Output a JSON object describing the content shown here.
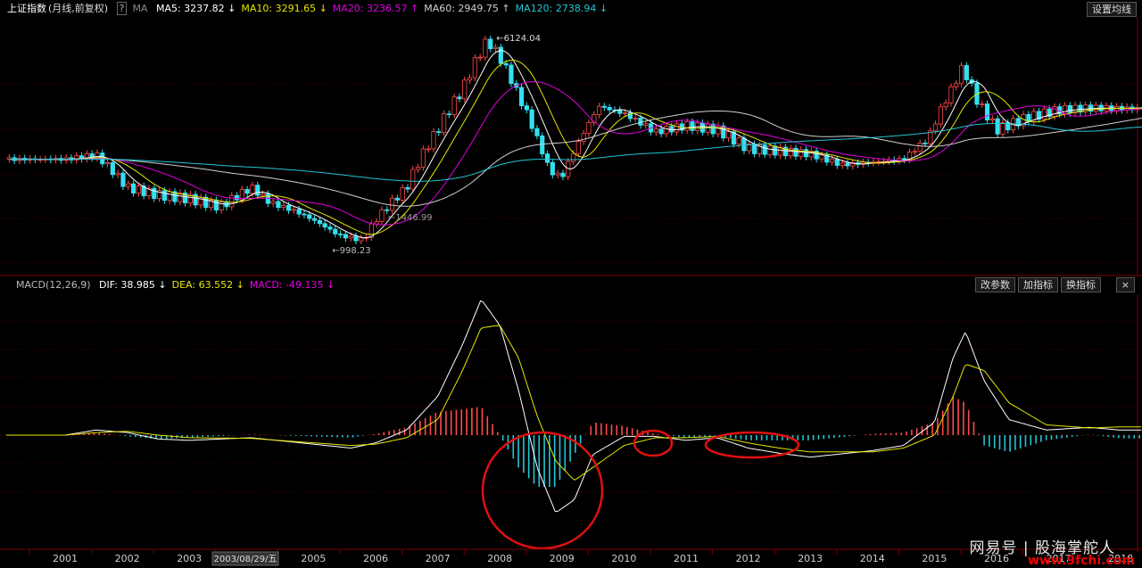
{
  "kline_header": {
    "title": "上证指数",
    "mode": "(月线,前复权)",
    "ma_label": "MA",
    "items": [
      {
        "text": "MA5: 3237.82 ↓",
        "color": "#ffffff"
      },
      {
        "text": "MA10: 3291.65 ↓",
        "color": "#e6e600"
      },
      {
        "text": "MA20: 3236.57 ↑",
        "color": "#e000e0"
      },
      {
        "text": "MA60: 2949.75 ↑",
        "color": "#cfcfcf"
      },
      {
        "text": "MA120: 2738.94 ↓",
        "color": "#23c6d6"
      }
    ],
    "set_ma_button": "设置均线"
  },
  "macd_header": {
    "title": "MACD(12,26,9)",
    "items": [
      {
        "text": "DIF: 38.985 ↓",
        "color": "#ffffff"
      },
      {
        "text": "DEA: 63.552 ↓",
        "color": "#e6e600"
      },
      {
        "text": "MACD: -49.135 ↓",
        "color": "#e000e0"
      }
    ],
    "buttons": [
      "改参数",
      "加指标",
      "换指标"
    ]
  },
  "price_annotations": {
    "high": "6124.04",
    "low": "998.23",
    "mid_low": "1446.99"
  },
  "cursor_date": "2003/08/29/五",
  "watermark": {
    "text": "网易号 | 股海掌舵人",
    "site": "www.9fchi.com"
  },
  "chart_data": {
    "type": "line",
    "title": "上证指数 (月线,前复权)",
    "x_labels": [
      "2001",
      "2002",
      "2003",
      "2004",
      "2005",
      "2006",
      "2007",
      "2008",
      "2009",
      "2010",
      "2011",
      "2012",
      "2013",
      "2014",
      "2015",
      "2016",
      "2017",
      "2018"
    ],
    "price_series": {
      "name": "上证指数",
      "x": [
        2001.0,
        2001.5,
        2002.0,
        2002.5,
        2003.0,
        2003.5,
        2004.0,
        2004.3,
        2004.7,
        2005.0,
        2005.4,
        2005.8,
        2006.0,
        2006.5,
        2007.0,
        2007.4,
        2007.8,
        2008.0,
        2008.3,
        2008.6,
        2008.8,
        2009.0,
        2009.3,
        2009.6,
        2010.0,
        2010.5,
        2011.0,
        2011.5,
        2012.0,
        2012.5,
        2013.0,
        2013.5,
        2014.0,
        2014.5,
        2014.9,
        2015.3,
        2015.45,
        2015.7,
        2016.0,
        2016.5,
        2017.0,
        2017.5,
        2018.0
      ],
      "y": [
        2100,
        2180,
        1650,
        1550,
        1500,
        1400,
        1650,
        1450,
        1350,
        1250,
        1100,
        1050,
        1250,
        1650,
        2700,
        3800,
        5800,
        5000,
        3600,
        2500,
        1900,
        1800,
        2500,
        3300,
        3100,
        2650,
        2800,
        2700,
        2300,
        2250,
        2200,
        2000,
        2050,
        2100,
        2500,
        3900,
        4600,
        3400,
        2700,
        3000,
        3200,
        3250,
        3240
      ]
    },
    "indicators": {
      "MA5": 3237.82,
      "MA10": 3291.65,
      "MA20": 3236.57,
      "MA60": 2949.75,
      "MA120": 2738.94,
      "DIF": 38.985,
      "DEA": 63.552,
      "MACD": -49.135
    },
    "macd": {
      "x": [
        2001.0,
        2001.5,
        2002.0,
        2002.5,
        2003.0,
        2004.0,
        2005.0,
        2005.6,
        2006.0,
        2006.5,
        2007.0,
        2007.4,
        2007.7,
        2008.0,
        2008.3,
        2008.6,
        2008.9,
        2009.2,
        2009.5,
        2010.0,
        2010.5,
        2011.0,
        2011.5,
        2012.0,
        2012.5,
        2013.0,
        2014.0,
        2014.5,
        2015.0,
        2015.3,
        2015.5,
        2015.8,
        2016.2,
        2016.8,
        2017.5,
        2018.0
      ],
      "dif": [
        0,
        40,
        20,
        -30,
        -40,
        -20,
        -70,
        -100,
        -60,
        40,
        300,
        700,
        1050,
        850,
        350,
        -250,
        -600,
        -500,
        -150,
        -10,
        -10,
        -40,
        -20,
        -100,
        -140,
        -170,
        -120,
        -80,
        100,
        600,
        800,
        420,
        120,
        40,
        60,
        39
      ],
      "dea": [
        0,
        20,
        30,
        0,
        -20,
        -25,
        -60,
        -80,
        -70,
        -20,
        120,
        500,
        830,
        850,
        600,
        150,
        -200,
        -350,
        -250,
        -80,
        -20,
        -20,
        -10,
        -60,
        -100,
        -130,
        -130,
        -100,
        0,
        300,
        550,
        500,
        250,
        80,
        55,
        64
      ]
    }
  }
}
